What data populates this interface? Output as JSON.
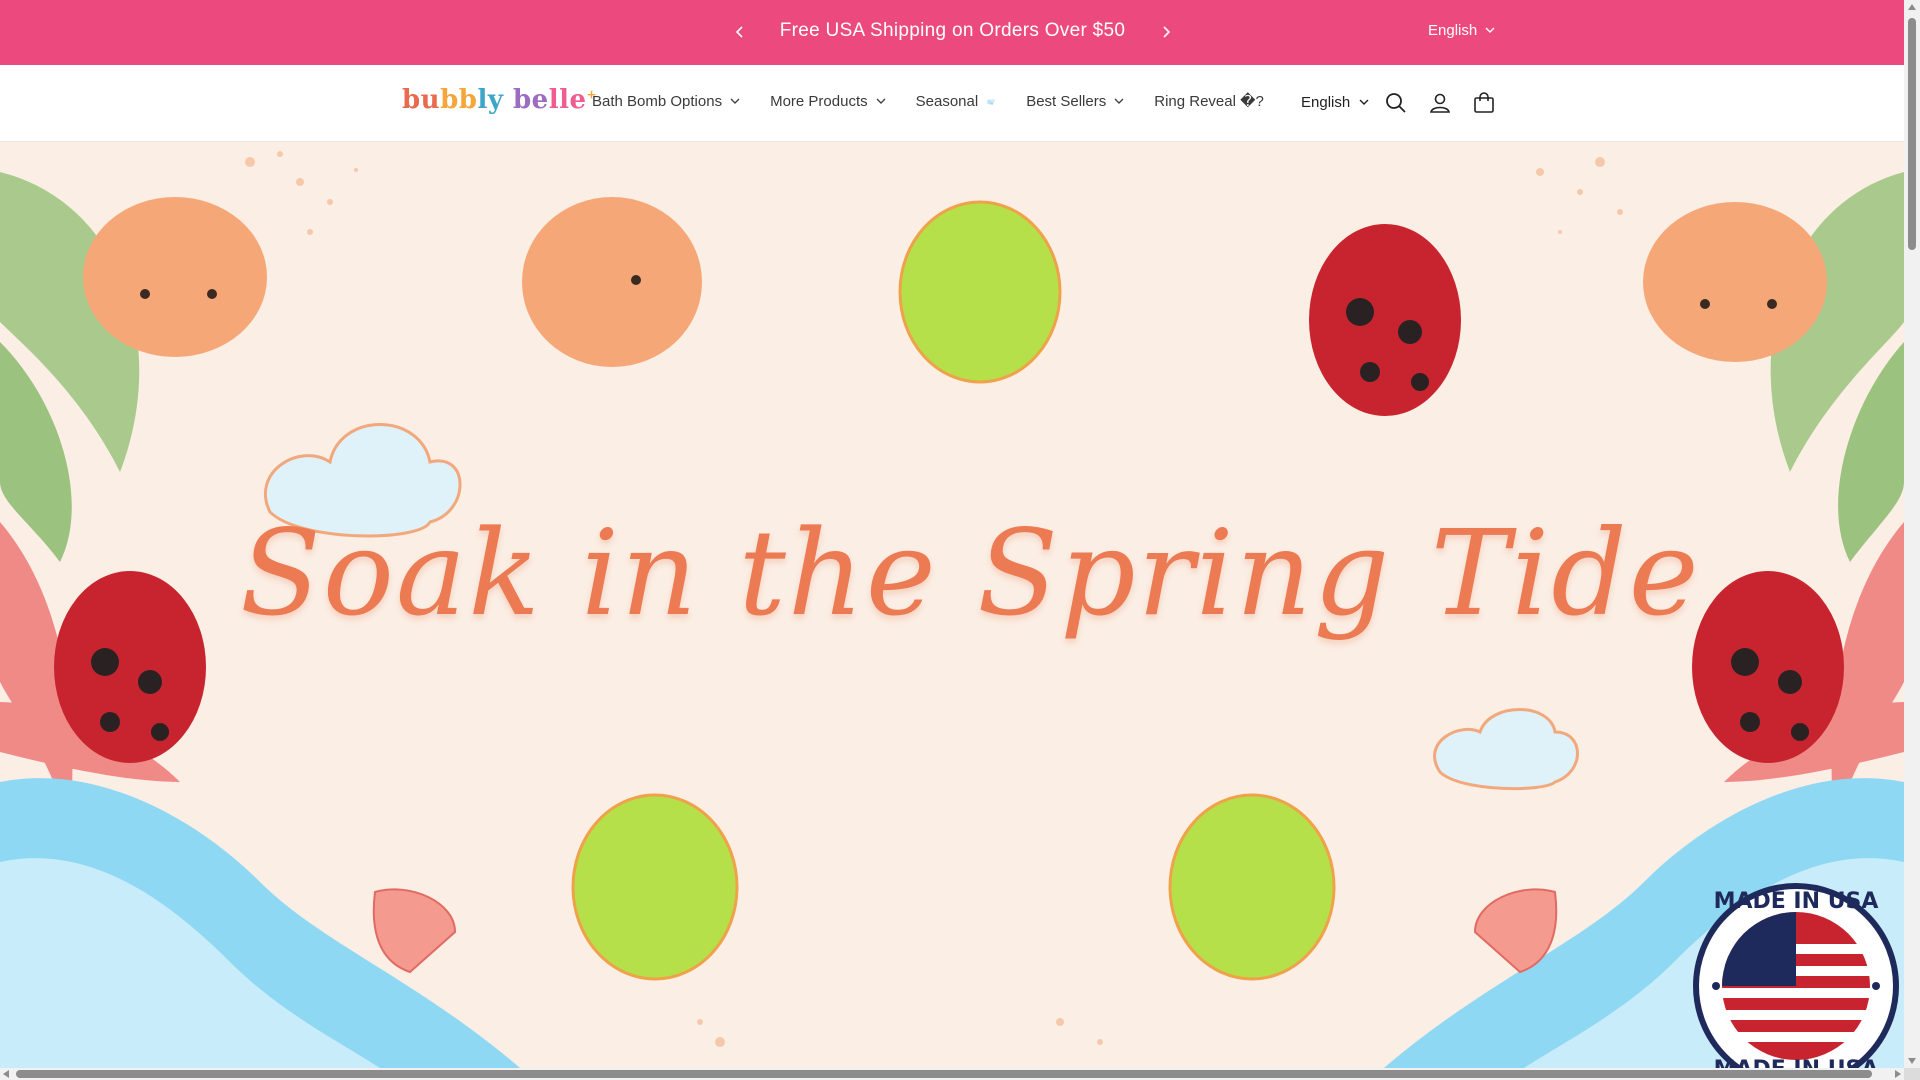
{
  "announcement": {
    "message": "Free USA Shipping on Orders Over $50",
    "language": "English",
    "prev_icon": "chevron-left-icon",
    "next_icon": "chevron-right-icon"
  },
  "header": {
    "logo": {
      "part1": "bu",
      "part2": "bb",
      "part3": "ly",
      "part4": " be",
      "part5": "lle",
      "mark": "+"
    },
    "nav": [
      {
        "label": "Bath Bomb Options",
        "dropdown": true
      },
      {
        "label": "More Products",
        "dropdown": true
      },
      {
        "label": "Seasonal",
        "dropdown": false,
        "icon": "bubble-icon"
      },
      {
        "label": "Best Sellers",
        "dropdown": true
      },
      {
        "label": "Ring Reveal �?",
        "dropdown": false
      }
    ],
    "language": "English",
    "icons": [
      "search-icon",
      "account-icon",
      "cart-icon"
    ]
  },
  "hero": {
    "title": "Soak in the Spring Tide",
    "badge": {
      "top_text": "MADE IN USA",
      "bottom_text": "MADE IN USA"
    }
  },
  "colors": {
    "announcement_bg": "#ec4a7e",
    "hero_bg": "#fbeee4",
    "title": "#ec7a52",
    "frog": "#f6a777",
    "turtle": "#b6e04a",
    "ladybug": "#c8242f",
    "water": "#8fd8f3",
    "leaf": "#a7c98b"
  }
}
